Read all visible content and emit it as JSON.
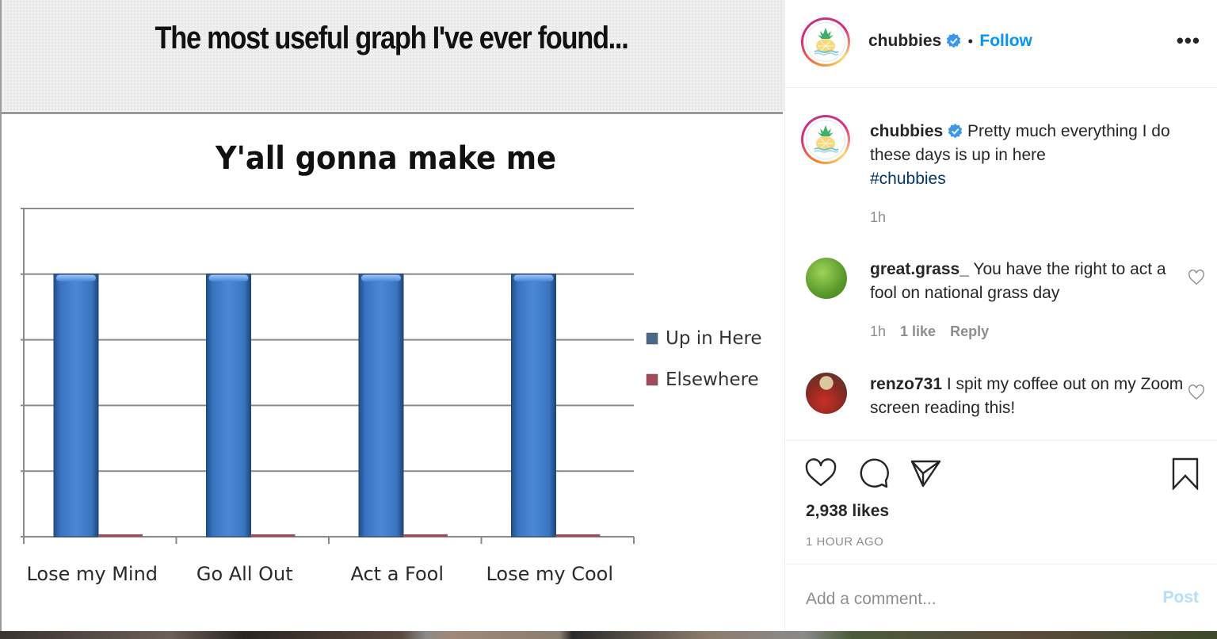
{
  "media": {
    "header_text": "The most useful graph I've ever found...",
    "chart_title": "Y'all gonna make me"
  },
  "chart_data": {
    "type": "bar",
    "title": "Y'all gonna make me",
    "xlabel": "",
    "ylabel": "",
    "categories": [
      "Lose my Mind",
      "Go All Out",
      "Act a Fool",
      "Lose my Cool"
    ],
    "series": [
      {
        "name": "Up in Here",
        "values": [
          4,
          4,
          4,
          4
        ],
        "color": "#3f7bc8"
      },
      {
        "name": "Elsewhere",
        "values": [
          0.03,
          0.03,
          0.03,
          0.03
        ],
        "color": "#a04a5a"
      }
    ],
    "ylim": [
      0,
      5
    ],
    "y_tick_labels": [],
    "grid": true,
    "legend": "right"
  },
  "header": {
    "username": "chubbies",
    "verified": true,
    "separator": "•",
    "follow_label": "Follow",
    "more_label": "•••"
  },
  "caption": {
    "username": "chubbies",
    "text": "Pretty much everything I do these days is up in here",
    "hashtag": "#chubbies",
    "time": "1h"
  },
  "comments": [
    {
      "username": "great.grass_",
      "text": "You have the right to act a fool on national grass day",
      "time": "1h",
      "likes": "1 like",
      "reply": "Reply"
    },
    {
      "username": "renzo731",
      "text": "I spit my coffee out on my Zoom screen reading this!"
    }
  ],
  "actions": {
    "likes": "2,938 likes",
    "time_ago": "1 HOUR AGO"
  },
  "add_comment": {
    "placeholder": "Add a comment...",
    "post_label": "Post"
  },
  "colors": {
    "accent": "#0095f6",
    "post_disabled": "#b2dffc",
    "hashtag": "#00376b",
    "muted": "#8e8e8e"
  }
}
